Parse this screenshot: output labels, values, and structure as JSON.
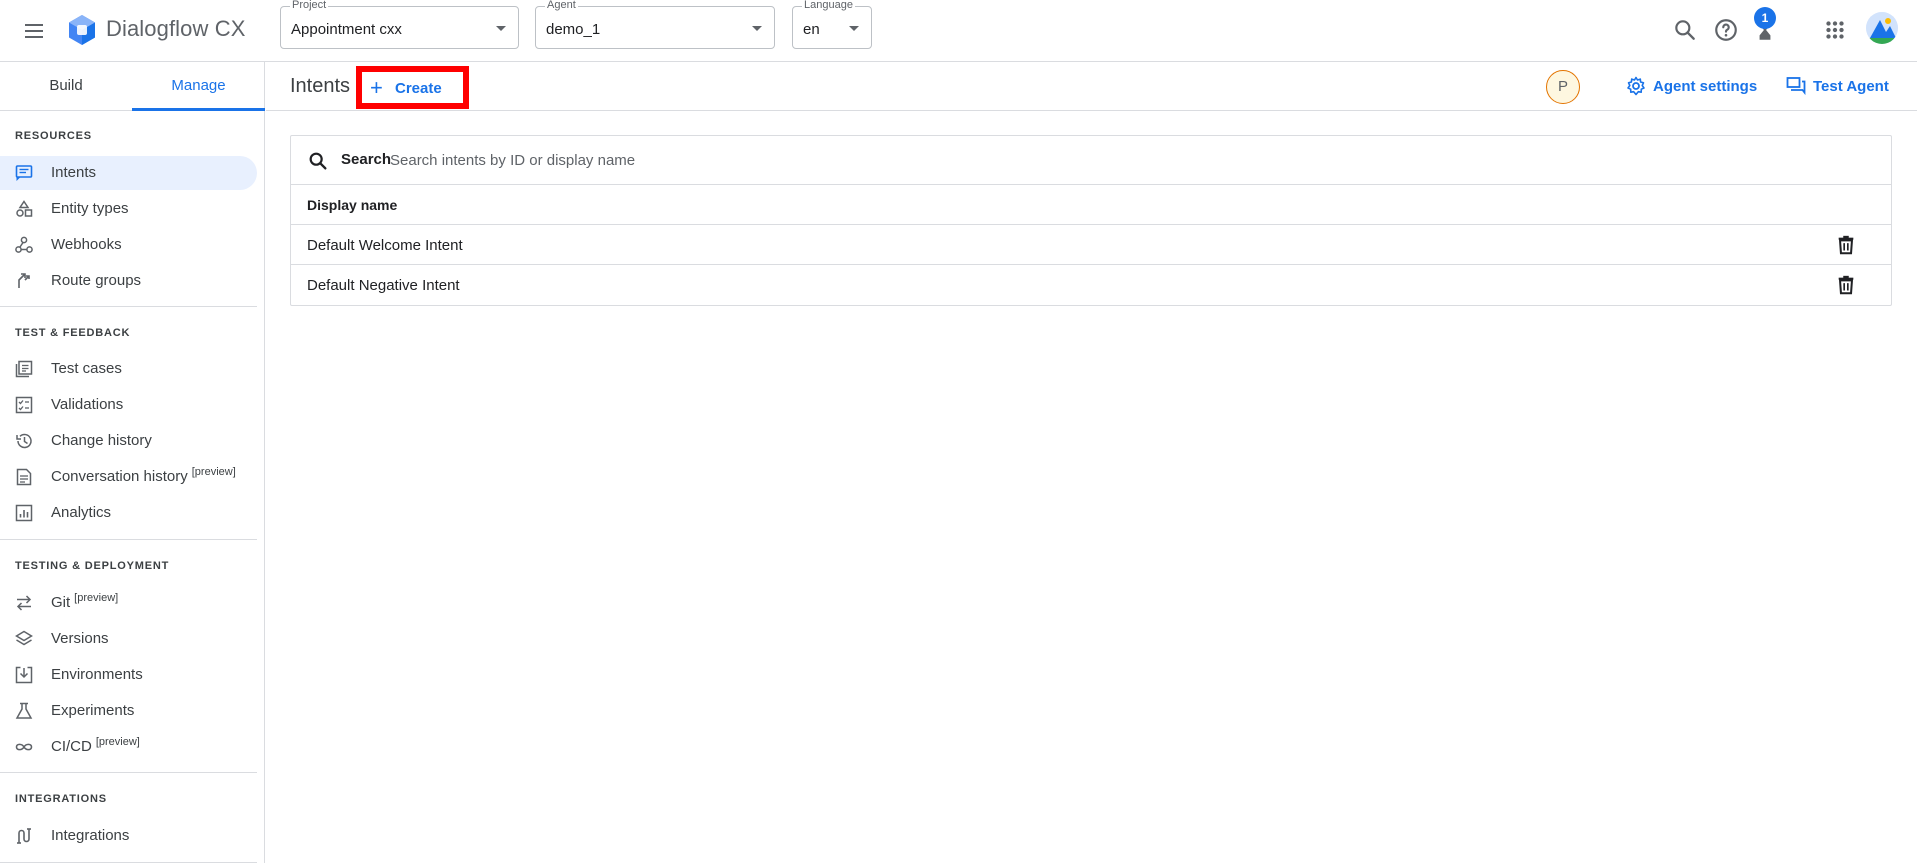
{
  "app": {
    "title": "Dialogflow CX"
  },
  "selectors": {
    "project": {
      "label": "Project",
      "value": "Appointment cxx"
    },
    "agent": {
      "label": "Agent",
      "value": "demo_1"
    },
    "language": {
      "label": "Language",
      "value": "en"
    }
  },
  "top_actions": {
    "notification_count": "1"
  },
  "sidebar": {
    "tabs": [
      {
        "label": "Build"
      },
      {
        "label": "Manage",
        "active": true
      }
    ],
    "sections": [
      {
        "heading": "RESOURCES",
        "items": [
          {
            "label": "Intents",
            "icon": "intents-icon",
            "active": true
          },
          {
            "label": "Entity types",
            "icon": "entity-types-icon"
          },
          {
            "label": "Webhooks",
            "icon": "webhooks-icon"
          },
          {
            "label": "Route groups",
            "icon": "route-groups-icon"
          }
        ]
      },
      {
        "heading": "TEST & FEEDBACK",
        "items": [
          {
            "label": "Test cases",
            "icon": "test-cases-icon"
          },
          {
            "label": "Validations",
            "icon": "validations-icon"
          },
          {
            "label": "Change history",
            "icon": "history-icon"
          },
          {
            "label": "Conversation history",
            "tag": "[preview]",
            "icon": "conversation-history-icon"
          },
          {
            "label": "Analytics",
            "icon": "analytics-icon"
          }
        ]
      },
      {
        "heading": "TESTING & DEPLOYMENT",
        "items": [
          {
            "label": "Git",
            "tag": "[preview]",
            "icon": "git-icon"
          },
          {
            "label": "Versions",
            "icon": "versions-icon"
          },
          {
            "label": "Environments",
            "icon": "environments-icon"
          },
          {
            "label": "Experiments",
            "icon": "experiments-icon"
          },
          {
            "label": "CI/CD",
            "tag": "[preview]",
            "icon": "cicd-icon"
          }
        ]
      },
      {
        "heading": "INTEGRATIONS",
        "items": [
          {
            "label": "Integrations",
            "icon": "integrations-icon"
          }
        ]
      }
    ]
  },
  "header": {
    "title": "Intents",
    "create_label": "Create",
    "user_initial": "P",
    "agent_settings_label": "Agent settings",
    "test_agent_label": "Test Agent"
  },
  "table": {
    "search_label": "Search",
    "search_placeholder": "Search intents by ID or display name",
    "column": "Display name",
    "rows": [
      {
        "name": "Default Welcome Intent"
      },
      {
        "name": "Default Negative Intent"
      }
    ]
  },
  "colors": {
    "accent": "#1a73e8",
    "highlight_border": "#ff0000",
    "active_nav_bg": "#e8f0fe",
    "divider": "#dadce0"
  }
}
